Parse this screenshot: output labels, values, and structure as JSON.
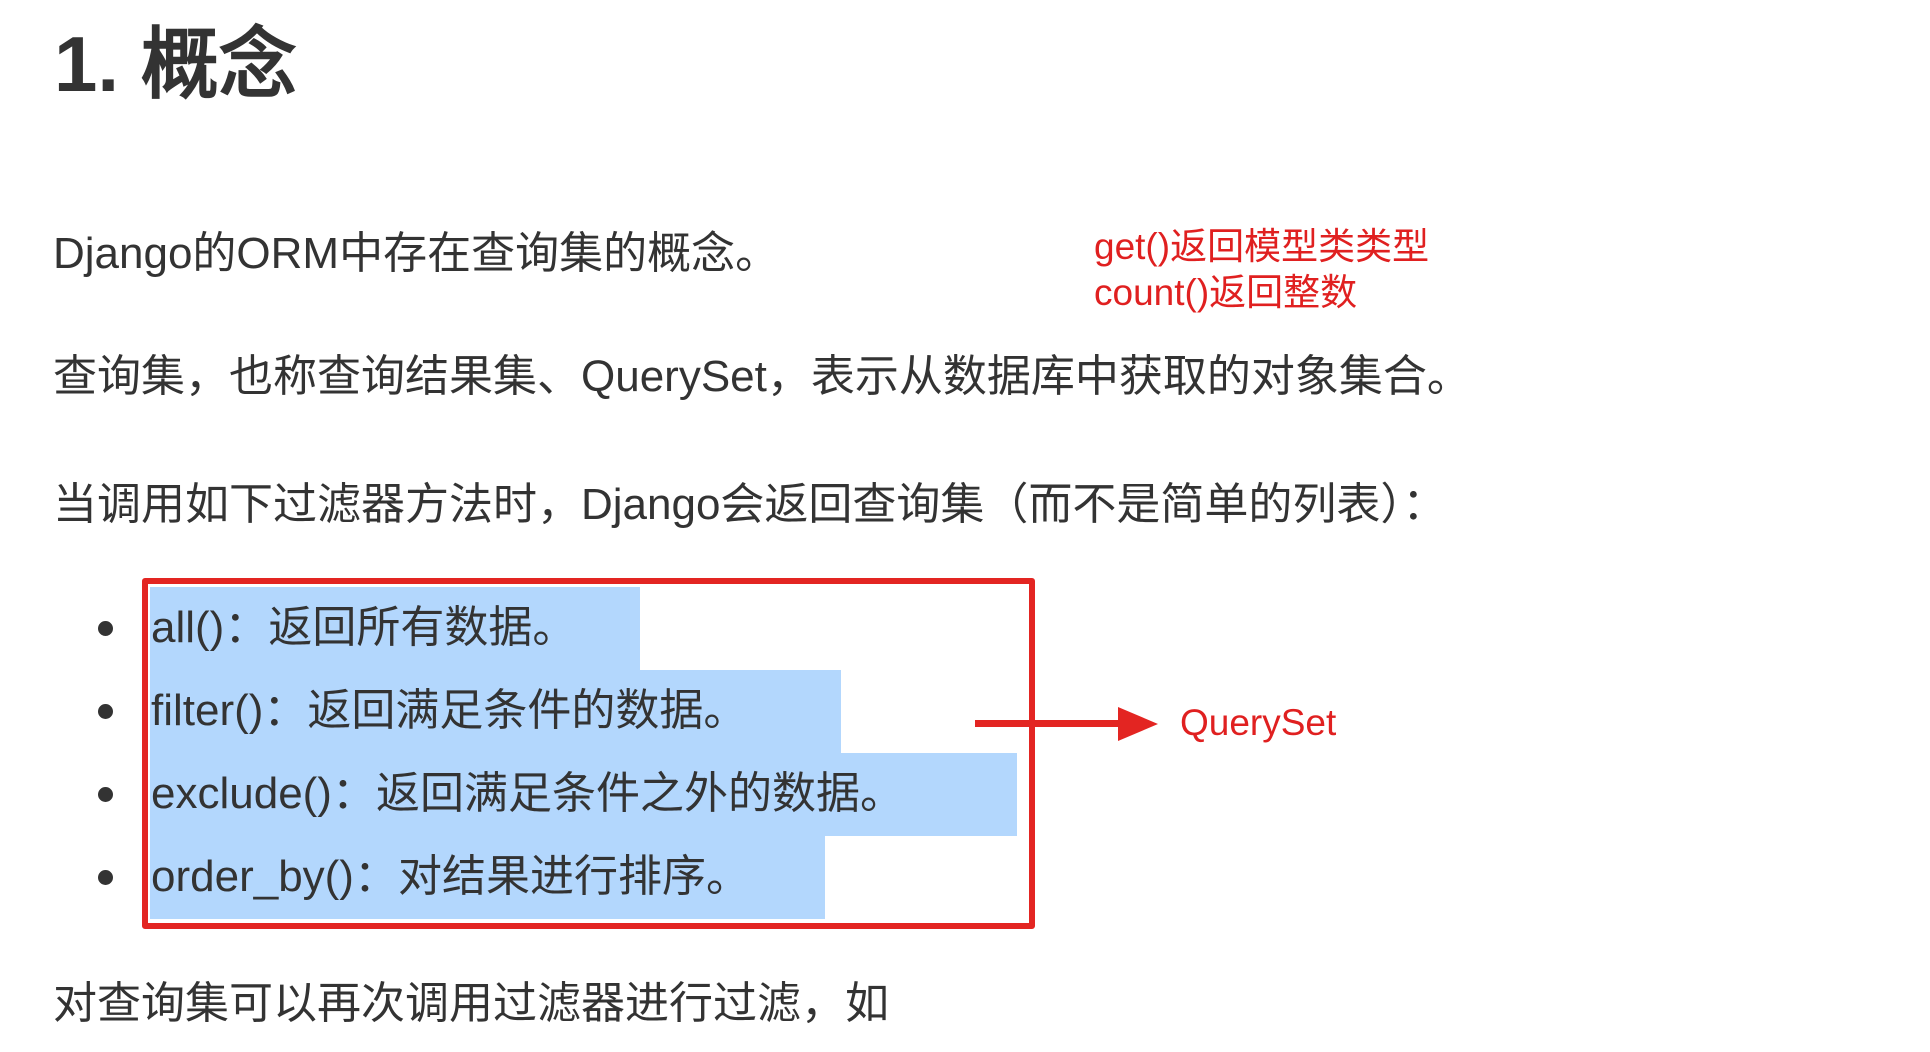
{
  "heading": "1. 概念",
  "paragraphs": {
    "p1": "Django的ORM中存在查询集的概念。",
    "p2": "查询集，也称查询结果集、QuerySet，表示从数据库中获取的对象集合。",
    "p3": "当调用如下过滤器方法时，Django会返回查询集（而不是简单的列表）：",
    "p4": "对查询集可以再次调用过滤器进行过滤，如"
  },
  "annotation_note": {
    "line1": "get()返回模型类类型",
    "line2": "count()返回整数"
  },
  "methods": [
    {
      "text": "all()：返回所有数据。"
    },
    {
      "text": "filter()：返回满足条件的数据。"
    },
    {
      "text": "exclude()：返回满足条件之外的数据。"
    },
    {
      "text": "order_by()：对结果进行排序。"
    }
  ],
  "arrow_label": "QuerySet",
  "colors": {
    "annotation": "#e32522",
    "selection": "#b3d7fd",
    "text": "#333333"
  }
}
